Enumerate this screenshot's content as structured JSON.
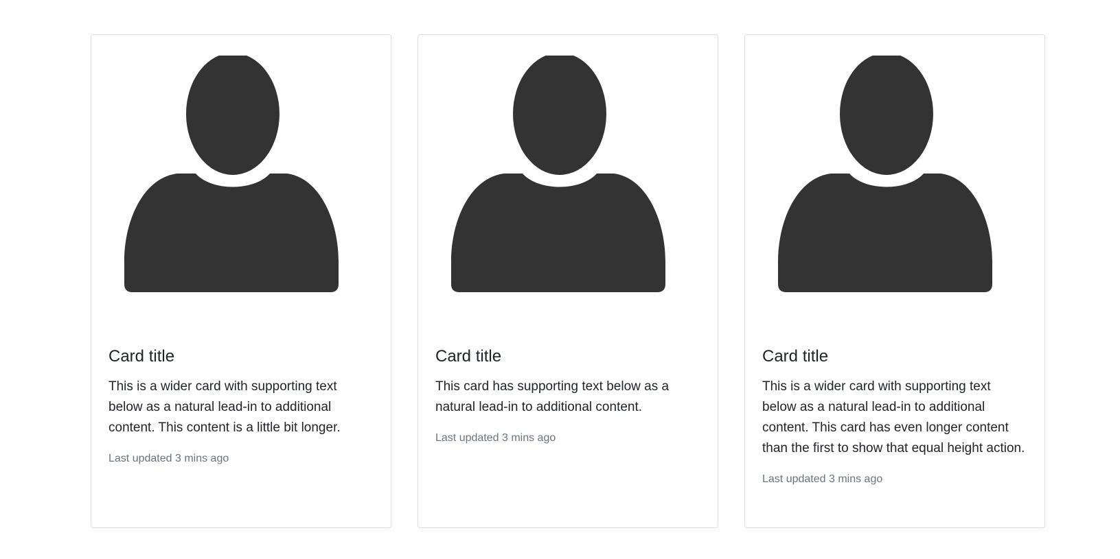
{
  "cards": [
    {
      "image_icon": "user-silhouette-icon",
      "title": "Card title",
      "text": "This is a wider card with supporting text below as a natural lead-in to additional content. This content is a little bit longer.",
      "meta": "Last updated 3 mins ago"
    },
    {
      "image_icon": "user-silhouette-icon",
      "title": "Card title",
      "text": "This card has supporting text below as a natural lead-in to additional content.",
      "meta": "Last updated 3 mins ago"
    },
    {
      "image_icon": "user-silhouette-icon",
      "title": "Card title",
      "text": "This is a wider card with supporting text below as a natural lead-in to additional content. This card has even longer content than the first to show that equal height action.",
      "meta": "Last updated 3 mins ago"
    }
  ],
  "colors": {
    "silhouette": "#333333",
    "muted_text": "#6c757d",
    "body_text": "#212529",
    "card_border": "#dfdfdf"
  }
}
